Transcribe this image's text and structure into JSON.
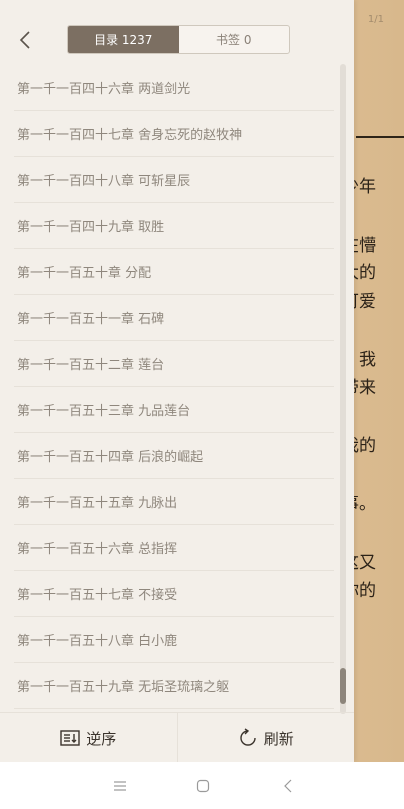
{
  "reader": {
    "page_indicator": "1/1",
    "text_fragments": [
      "少年",
      "在懵",
      "大的",
      "可爱",
      "，我",
      "带来",
      "，",
      "我的",
      "事。",
      "这又",
      "你的"
    ]
  },
  "header": {
    "tabs": [
      {
        "label": "目录 1237",
        "active": true
      },
      {
        "label": "书签 0",
        "active": false
      }
    ]
  },
  "chapters": [
    {
      "title": "第一千一百四十六章 两道剑光"
    },
    {
      "title": "第一千一百四十七章 舍身忘死的赵牧神"
    },
    {
      "title": "第一千一百四十八章 可斩星辰"
    },
    {
      "title": "第一千一百四十九章 取胜"
    },
    {
      "title": "第一千一百五十章 分配"
    },
    {
      "title": "第一千一百五十一章 石碑"
    },
    {
      "title": "第一千一百五十二章 莲台"
    },
    {
      "title": "第一千一百五十三章 九品莲台"
    },
    {
      "title": "第一千一百五十四章 后浪的崛起"
    },
    {
      "title": "第一千一百五十五章 九脉出"
    },
    {
      "title": "第一千一百五十六章 总指挥"
    },
    {
      "title": "第一千一百五十七章 不接受"
    },
    {
      "title": "第一千一百五十八章 白小鹿"
    },
    {
      "title": "第一千一百五十九章 无垢圣琉璃之躯"
    }
  ],
  "footer": {
    "reverse_label": "逆序",
    "refresh_label": "刷新"
  },
  "colors": {
    "panel_bg": "#f3efe9",
    "tab_active_bg": "#7c6f62",
    "chapter_text": "#8f877d"
  }
}
